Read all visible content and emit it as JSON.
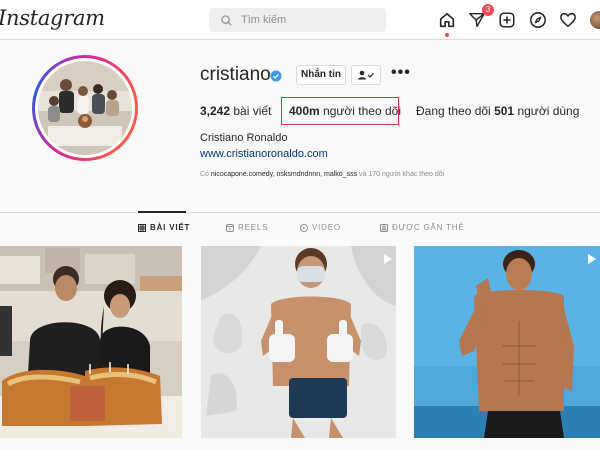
{
  "header": {
    "logo": "Instagram",
    "search_placeholder": "Tìm kiếm",
    "notification_count": "3"
  },
  "profile": {
    "username": "cristiano",
    "message_button": "Nhắn tin",
    "posts_count": "3,242",
    "posts_label": "bài viết",
    "followers_count": "400m",
    "followers_label": "người theo dõi",
    "following_prefix": "Đang theo dõi",
    "following_count": "501",
    "following_suffix": "người dùng",
    "full_name": "Cristiano Ronaldo",
    "website": "www.cristianoronaldo.com",
    "followed_by_prefix": "Có",
    "followed_by_users": "nicocapone.comedy, nsksmdndnnn, malko_sss",
    "followed_by_suffix": "và 170 người khác theo dõi"
  },
  "tabs": [
    {
      "label": "BÀI VIẾT",
      "icon": "grid-icon",
      "active": true
    },
    {
      "label": "REELS",
      "icon": "reels-icon",
      "active": false
    },
    {
      "label": "VIDEO",
      "icon": "video-icon",
      "active": false
    },
    {
      "label": "ĐƯỢC GẮN THẺ",
      "icon": "tagged-icon",
      "active": false
    }
  ],
  "posts": [
    {
      "description": "birthday-cake-photo",
      "type": "image"
    },
    {
      "description": "thumbs-up-mask-photo",
      "type": "reel"
    },
    {
      "description": "beach-shirtless-photo",
      "type": "reel"
    }
  ],
  "colors": {
    "highlight": "#d83040",
    "verified": "#3897f0",
    "link": "#00376b",
    "badge": "#ed4956"
  }
}
